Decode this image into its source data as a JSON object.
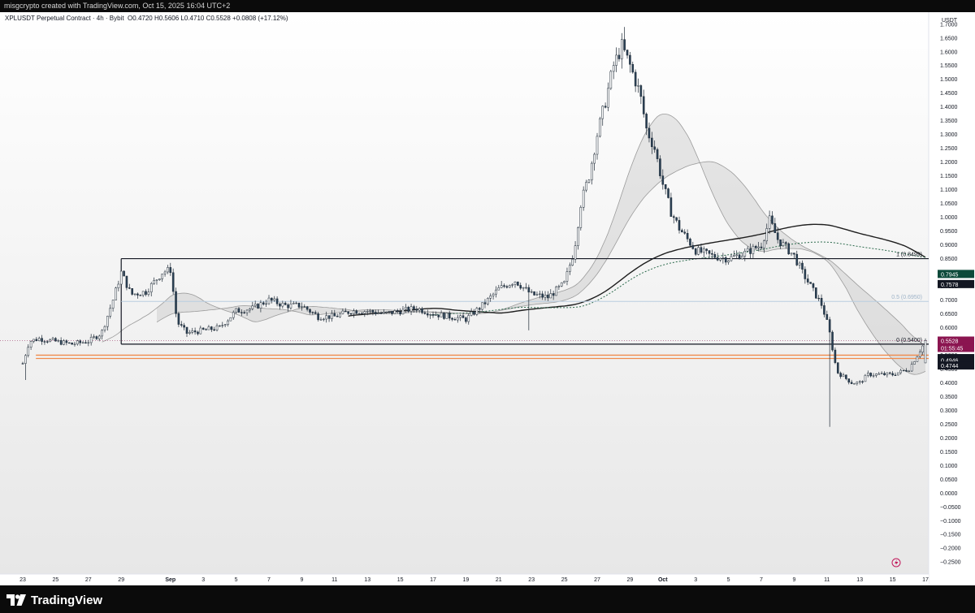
{
  "header": {
    "attribution": "misgcrypto created with TradingView.com, Oct 15, 2025 16:04 UTC+2",
    "symbol_info": "XPLUSDT Perpetual Contract · 4h · Bybit",
    "ohlc": "O0.4720  H0.5606  L0.4710  C0.5528  +0.0808 (+17.12%)",
    "currency": "USDT"
  },
  "footer": {
    "brand": "TradingView"
  },
  "colors": {
    "up": "#ffffff",
    "down": "#2a4055",
    "wick": "#1e2a36",
    "orange": "#f08a4b",
    "fib_blue": "#b9cde0"
  },
  "chart_data": {
    "type": "candlestick",
    "title": "XPLUSDT Perpetual Contract · 4h · Bybit",
    "ylabel": "USDT",
    "ylim": [
      -0.27,
      1.72
    ],
    "y_ticks": [
      "1.7000",
      "1.6500",
      "1.6000",
      "1.5500",
      "1.5000",
      "1.4500",
      "1.4000",
      "1.3500",
      "1.3000",
      "1.2500",
      "1.2000",
      "1.1500",
      "1.1000",
      "1.0500",
      "1.0000",
      "0.9500",
      "0.9000",
      "0.8500",
      "0.8000",
      "0.7500",
      "0.7000",
      "0.6500",
      "0.6000",
      "0.5500",
      "0.5000",
      "0.4500",
      "0.4000",
      "0.3500",
      "0.3000",
      "0.2500",
      "0.2000",
      "0.1500",
      "0.1000",
      "0.0500",
      "0.0000",
      "−0.0500",
      "−0.1000",
      "−0.1500",
      "−0.2000",
      "−0.2500"
    ],
    "y_tick_values": [
      1.7,
      1.65,
      1.6,
      1.55,
      1.5,
      1.45,
      1.4,
      1.35,
      1.3,
      1.25,
      1.2,
      1.15,
      1.1,
      1.05,
      1.0,
      0.95,
      0.9,
      0.85,
      0.8,
      0.75,
      0.7,
      0.65,
      0.6,
      0.55,
      0.5,
      0.45,
      0.4,
      0.35,
      0.3,
      0.25,
      0.2,
      0.15,
      0.1,
      0.05,
      0.0,
      -0.05,
      -0.1,
      -0.15,
      -0.2,
      -0.25
    ],
    "x_ticks": [
      "23",
      "25",
      "27",
      "29",
      "Sep",
      "3",
      "5",
      "7",
      "9",
      "11",
      "13",
      "15",
      "17",
      "19",
      "21",
      "23",
      "25",
      "27",
      "29",
      "Oct",
      "3",
      "5",
      "7",
      "9",
      "11",
      "13",
      "15",
      "17"
    ],
    "x_tick_days": [
      0,
      2,
      4,
      6,
      9,
      11,
      13,
      15,
      17,
      19,
      21,
      23,
      25,
      27,
      29,
      31,
      33,
      35,
      37,
      39,
      41,
      43,
      45,
      47,
      49,
      51,
      53,
      55
    ],
    "price_path": [
      [
        0,
        0.47
      ],
      [
        0.4,
        0.55
      ],
      [
        1,
        0.56
      ],
      [
        2,
        0.55
      ],
      [
        3,
        0.54
      ],
      [
        4,
        0.55
      ],
      [
        4.8,
        0.58
      ],
      [
        5.5,
        0.7
      ],
      [
        6,
        0.8
      ],
      [
        6.6,
        0.72
      ],
      [
        7.5,
        0.73
      ],
      [
        8.5,
        0.8
      ],
      [
        9,
        0.81
      ],
      [
        9.4,
        0.62
      ],
      [
        10,
        0.58
      ],
      [
        11,
        0.59
      ],
      [
        12,
        0.6
      ],
      [
        13,
        0.66
      ],
      [
        14,
        0.67
      ],
      [
        15,
        0.7
      ],
      [
        16,
        0.68
      ],
      [
        17,
        0.68
      ],
      [
        18,
        0.64
      ],
      [
        19,
        0.64
      ],
      [
        20,
        0.66
      ],
      [
        21,
        0.66
      ],
      [
        22,
        0.65
      ],
      [
        23,
        0.66
      ],
      [
        24,
        0.67
      ],
      [
        25,
        0.65
      ],
      [
        26,
        0.64
      ],
      [
        27,
        0.63
      ],
      [
        28,
        0.68
      ],
      [
        29,
        0.74
      ],
      [
        30,
        0.77
      ],
      [
        31,
        0.72
      ],
      [
        32,
        0.71
      ],
      [
        33,
        0.76
      ],
      [
        33.6,
        0.88
      ],
      [
        34,
        1.05
      ],
      [
        34.5,
        1.15
      ],
      [
        35,
        1.3
      ],
      [
        35.5,
        1.42
      ],
      [
        36,
        1.55
      ],
      [
        36.5,
        1.62
      ],
      [
        37,
        1.55
      ],
      [
        37.6,
        1.45
      ],
      [
        38,
        1.32
      ],
      [
        38.5,
        1.25
      ],
      [
        39,
        1.12
      ],
      [
        39.5,
        1.02
      ],
      [
        40,
        0.96
      ],
      [
        41,
        0.88
      ],
      [
        42,
        0.86
      ],
      [
        43,
        0.85
      ],
      [
        44,
        0.87
      ],
      [
        45,
        0.9
      ],
      [
        45.5,
        0.99
      ],
      [
        46,
        0.92
      ],
      [
        47,
        0.86
      ],
      [
        47.5,
        0.8
      ],
      [
        48,
        0.75
      ],
      [
        48.7,
        0.68
      ],
      [
        49.1,
        0.6
      ],
      [
        49.6,
        0.44
      ],
      [
        50.5,
        0.4
      ],
      [
        51,
        0.4
      ],
      [
        51.5,
        0.43
      ],
      [
        52,
        0.43
      ],
      [
        53,
        0.43
      ],
      [
        54,
        0.45
      ],
      [
        54.5,
        0.5
      ],
      [
        55,
        0.55
      ]
    ],
    "key_wicks": [
      {
        "day": 49.15,
        "low": 0.24
      },
      {
        "day": 36.7,
        "high": 1.69
      },
      {
        "day": 0.15,
        "low": 0.41
      },
      {
        "day": 30.8,
        "low": 0.59
      }
    ],
    "horizontal_levels": [
      {
        "label": "1 (0.8499)",
        "value": 0.8499
      },
      {
        "label": "0.5 (0.6950)",
        "value": 0.695
      },
      {
        "label": "0 (0.5400)",
        "value": 0.54
      },
      {
        "value": 0.54
      },
      {
        "value": 0.4946
      },
      {
        "value": 0.4946
      }
    ],
    "price_labels": [
      {
        "text": "0.7945",
        "value": 0.7945,
        "color": "#0d4a3a"
      },
      {
        "text": "0.7578",
        "value": 0.7578,
        "color": "#131722"
      },
      {
        "text": "0.5528",
        "value": 0.5528,
        "color": "#8b1550"
      },
      {
        "text": "01:55:45",
        "value": 0.5528,
        "color": "#8b1550"
      },
      {
        "text": "0.5335",
        "value": 0.5335,
        "color": "#131722"
      },
      {
        "text": "0.4946",
        "value": 0.4946,
        "color": "#131722"
      },
      {
        "text": "0.4744",
        "value": 0.4744,
        "color": "#131722"
      }
    ]
  }
}
